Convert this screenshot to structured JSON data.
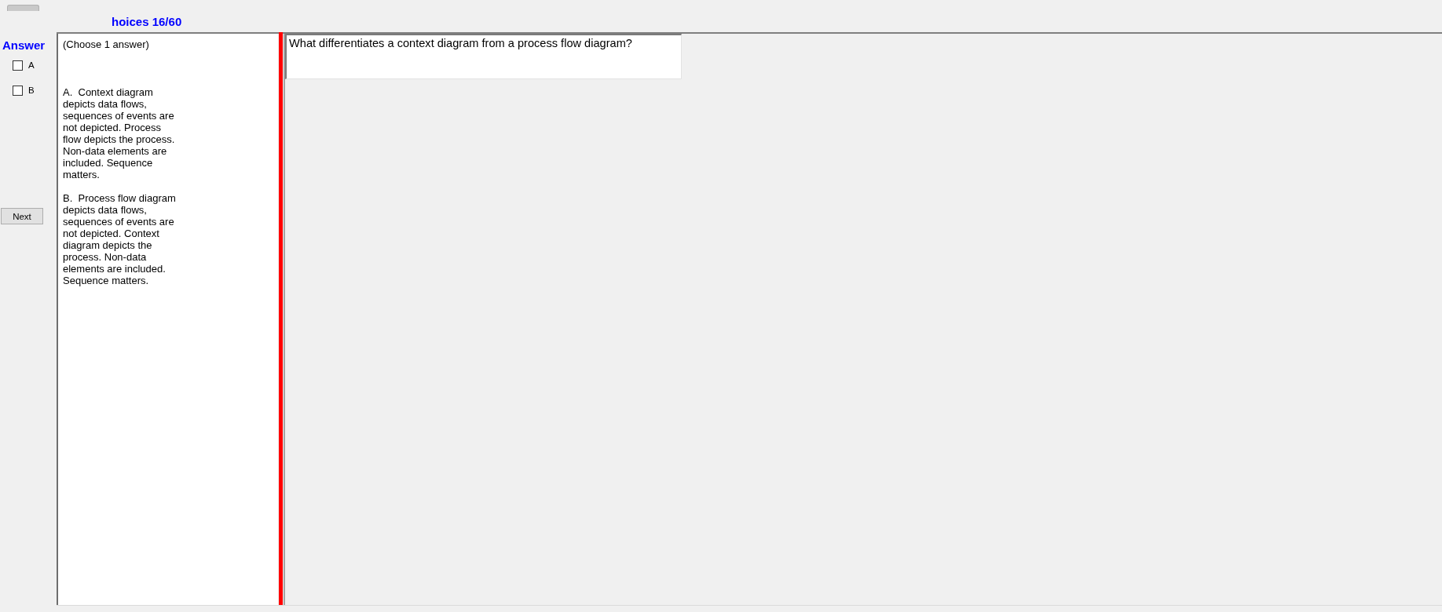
{
  "header": {
    "title": "hoices 16/60"
  },
  "answer_panel": {
    "title": "Answer",
    "options": [
      {
        "label": "A",
        "checked": false
      },
      {
        "label": "B",
        "checked": false
      }
    ],
    "next_button": "Next"
  },
  "choices_panel": {
    "instruction": "(Choose 1 answer)",
    "options": [
      "A.  Context diagram depicts data flows, sequences of events are not depicted. Process flow depicts the process. Non-data elements are included. Sequence matters.",
      "B.  Process flow diagram depicts data flows, sequences of events are not depicted. Context diagram depicts the process. Non-data elements are included. Sequence matters."
    ]
  },
  "question": {
    "text": "What differentiates a context diagram from a process flow diagram?"
  }
}
